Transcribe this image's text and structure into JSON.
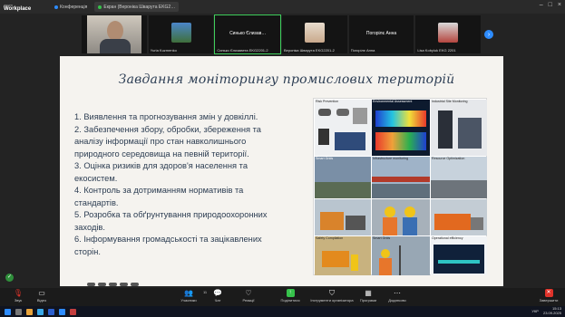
{
  "window": {
    "brand_top": "zoom",
    "brand_bottom": "Workplace",
    "tabs": [
      {
        "label": "Конференція",
        "active": false
      },
      {
        "label": "Екран (Вероніка Шварута EKG2…",
        "active": true
      }
    ]
  },
  "participants": [
    {
      "name": "",
      "type": "video",
      "color": "#9a8f86"
    },
    {
      "name": "Yuria Kuzmenko",
      "type": "video",
      "color": "#3f6f3a"
    },
    {
      "name": "Синько Єлизав…",
      "type": "highlight",
      "color": "#141414"
    },
    {
      "name": "Вероніка Шварута EKG2201-2",
      "type": "video",
      "color": "#c9a98c"
    },
    {
      "name": "Погорілє Анна",
      "type": "label",
      "color": "#141414"
    },
    {
      "name": "Lisa Kobyluk EKG 2201",
      "type": "video",
      "color": "#b5453e"
    }
  ],
  "tile_sublabels": [
    "",
    "",
    "Синько Єлизавета EKG2201-2",
    "",
    "Погорілє Анна",
    ""
  ],
  "slide": {
    "title": "Завдання моніторингу промислових територій",
    "tasks": [
      "1. Виявлення та прогнозування змін у довкіллі.",
      "2. Забезпечення збору, обробки, збереження та аналізу інформації про стан навколишнього природного середовища на певній території.",
      "3. Оцінка ризиків для здоров'я населення та екосистем.",
      "4. Контроль за дотриманням нормативів та стандартів.",
      "5. Розробка та обґрунтування природоохоронних заходів.",
      "6. Інформування громадськості та зацікавлених сторін."
    ],
    "collage_labels": [
      "Risk Prevention",
      "Environmental Assessment",
      "Industrial Site Monitoring",
      "Smart Grids",
      "Infrastructure monitoring",
      "Resource Optimization",
      "Safety Compilation",
      "Smart Grids",
      "Operational efficiency"
    ]
  },
  "toolbar": {
    "buttons": [
      {
        "label": "Звук",
        "icon": "mic-icon"
      },
      {
        "label": "Відео",
        "icon": "video-icon"
      },
      {
        "label": "Учасники",
        "icon": "participants-icon"
      },
      {
        "label": "Чат",
        "icon": "chat-icon"
      },
      {
        "label": "Реакції",
        "icon": "reactions-icon"
      },
      {
        "label": "Поділитися",
        "icon": "share-icon"
      },
      {
        "label": "Інструменти організатора",
        "icon": "host-tools-icon"
      },
      {
        "label": "Програми",
        "icon": "apps-icon"
      },
      {
        "label": "Додатково",
        "icon": "more-icon"
      },
      {
        "label": "Завершити",
        "icon": "end-icon"
      }
    ],
    "participant_count": "11"
  },
  "taskbar": {
    "lang": "УКР",
    "time": "15:13",
    "date": "23.09.2025"
  }
}
